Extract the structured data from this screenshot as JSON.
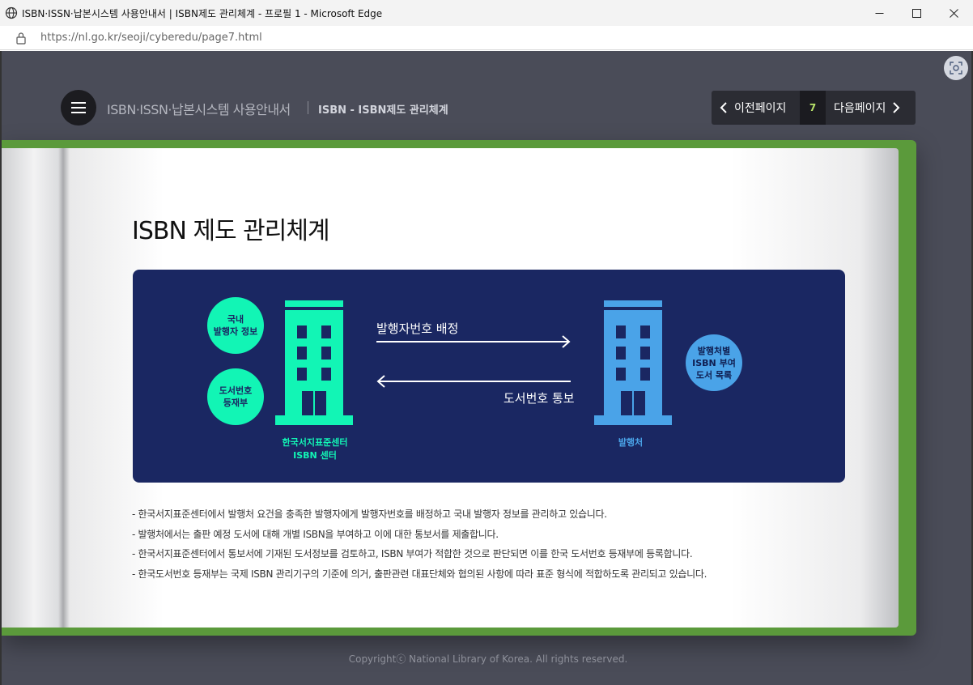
{
  "window": {
    "title": "ISBN·ISSN·납본시스템 사용안내서 | ISBN제도 관리체계 - 프로필 1 - Microsoft Edge",
    "minimize_icon": "minimize-icon",
    "maximize_icon": "maximize-icon",
    "close_icon": "close-icon"
  },
  "address": {
    "url": "https://nl.go.kr/seoji/cyberedu/page7.html"
  },
  "header": {
    "site_title": "ISBN·ISSN·납본시스템 사용안내서",
    "section_title": "ISBN - ISBN제도 관리체계",
    "prev_label": "이전페이지",
    "page_number": "7",
    "next_label": "다음페이지"
  },
  "content": {
    "heading": "ISBN 제도 관리체계",
    "diagram": {
      "circle_domestic_line1": "국내",
      "circle_domestic_line2": "발행자 정보",
      "circle_registry_line1": "도서번호",
      "circle_registry_line2": "등재부",
      "circle_publisher_line1": "발행처별",
      "circle_publisher_line2": "ISBN 부여",
      "circle_publisher_line3": "도서 목록",
      "arrow_assign": "발행자번호 배정",
      "arrow_notify": "도서번호 통보",
      "center_label_line1": "한국서지표준센터",
      "center_label_line2": "ISBN 센터",
      "publisher_label": "발행처",
      "colors": {
        "background": "#1a2762",
        "center": "#12f5b5",
        "publisher": "#4aa3e8"
      }
    },
    "notes": [
      "- 한국서지표준센터에서 발행처 요건을 충족한 발행자에게 발행자번호를 배정하고 국내 발행자 정보를 관리하고 있습니다.",
      "- 발행처에서는 출판 예정 도서에 대해 개별 ISBN을 부여하고 이에 대한 통보서를 제출합니다.",
      "- 한국서지표준센터에서 통보서에 기재된 도서정보를 검토하고, ISBN 부여가 적합한 것으로 판단되면 이를 한국 도서번호 등재부에 등록합니다.",
      "- 한국도서번호 등재부는 국제 ISBN 관리기구의 기준에 의거, 출판관련 대표단체와 협의된 사항에 따라 표준 형식에 적합하도록 관리되고 있습니다."
    ]
  },
  "footer": {
    "copyright": "Copyrightⓒ National Library of Korea. All rights reserved."
  }
}
